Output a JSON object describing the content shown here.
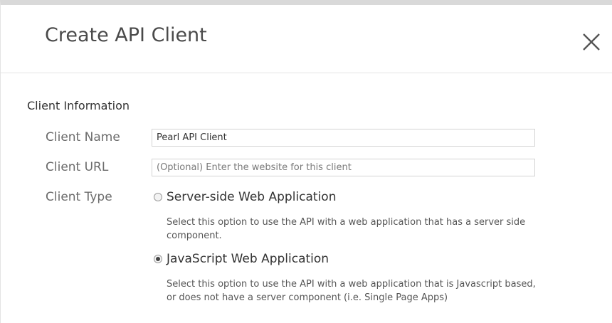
{
  "dialog": {
    "title": "Create API Client",
    "close_label": "×"
  },
  "section": {
    "title": "Client Information"
  },
  "fields": {
    "client_name": {
      "label": "Client Name",
      "value": "Pearl API Client"
    },
    "client_url": {
      "label": "Client URL",
      "value": "",
      "placeholder": "(Optional) Enter the website for this client"
    },
    "client_type": {
      "label": "Client Type",
      "options": [
        {
          "label": "Server-side Web Application",
          "description": "Select this option to use the API with a web application that has a server side component.",
          "selected": false
        },
        {
          "label": "JavaScript Web Application",
          "description": "Select this option to use the API with a web application that is Javascript based, or does not have a server component (i.e. Single Page Apps)",
          "selected": true
        }
      ]
    }
  },
  "icons": {
    "close": "close-icon",
    "radio": "radio-icon"
  },
  "colors": {
    "title_text": "#4a4a4a",
    "label_text": "#6b6b6b",
    "border": "#d3d3d3",
    "header_divider": "#e5e5e5",
    "close_icon": "#555555"
  }
}
